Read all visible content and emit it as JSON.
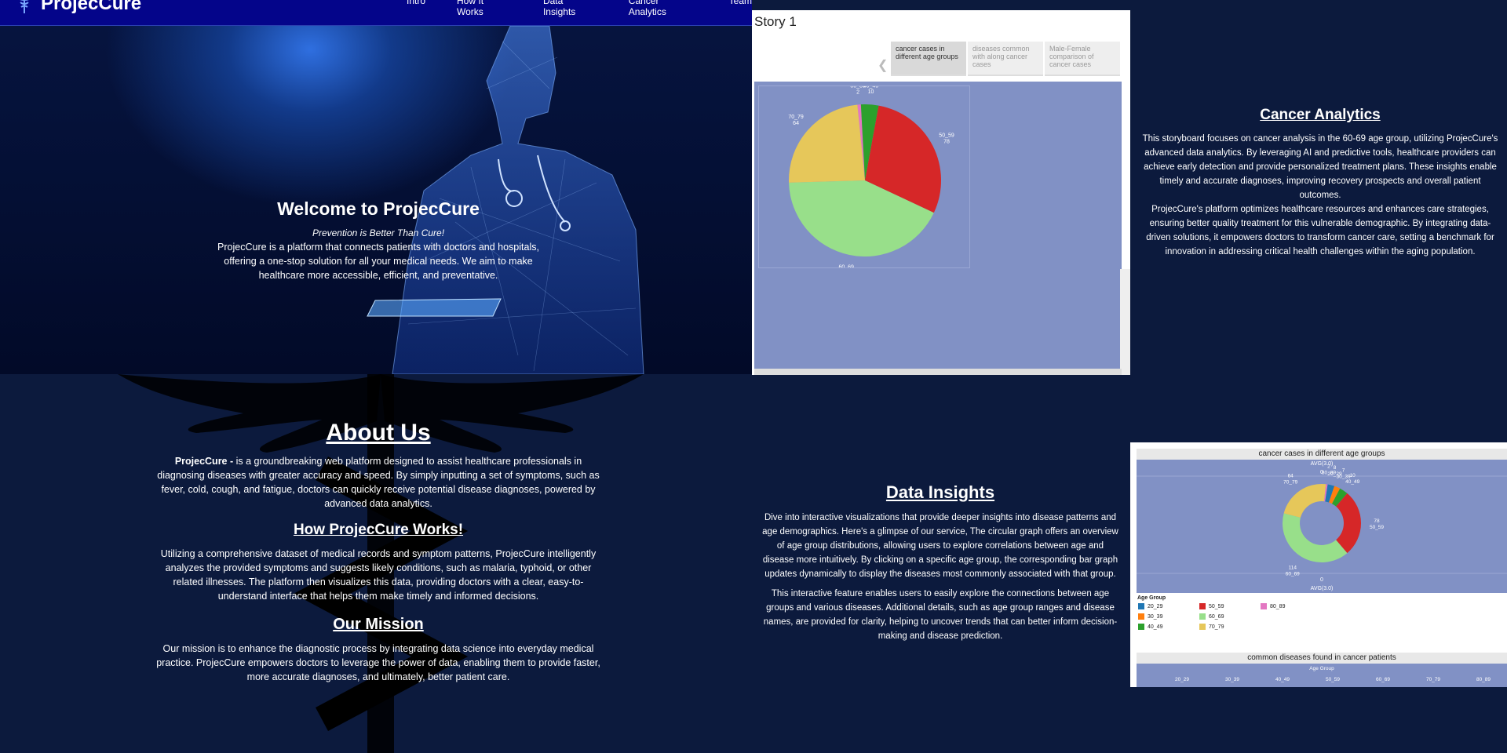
{
  "nav": {
    "brand": "ProjecCure",
    "links": [
      "Intro",
      "How It Works",
      "Data Insights",
      "Cancer Analytics",
      "Team"
    ]
  },
  "hero": {
    "title": "Welcome to ProjecCure",
    "subtitle": "Prevention is Better Than Cure!",
    "description": "ProjecCure is a platform that connects patients with doctors and hospitals, offering a one-stop solution for all your medical needs. We aim to make healthcare more accessible, efficient, and preventative."
  },
  "about": {
    "title": "About Us",
    "brand_bold": "ProjecCure -",
    "text": " is a groundbreaking web platform designed to assist healthcare professionals in diagnosing diseases with greater accuracy and speed. By simply inputting a set of symptoms, such as fever, cold, cough, and fatigue, doctors can quickly receive potential disease diagnoses, powered by advanced data analytics."
  },
  "how": {
    "title": "How ProjecCure Works!",
    "text": "Utilizing a comprehensive dataset of medical records and symptom patterns, ProjecCure intelligently analyzes the provided symptoms and suggests likely conditions, such as malaria, typhoid, or other related illnesses. The platform then visualizes this data, providing doctors with a clear, easy-to-understand interface that helps them make timely and informed decisions."
  },
  "mission": {
    "title": "Our Mission",
    "text": "Our mission is to enhance the diagnostic process by integrating data science into everyday medical practice. ProjecCure empowers doctors to leverage the power of data, enabling them to provide faster, more accurate diagnoses, and ultimately, better patient care."
  },
  "story": {
    "title": "Story 1",
    "tabs": [
      "cancer cases in different age groups",
      "diseases common with along cancer cases",
      "Male-Female comparison of cancer cases"
    ]
  },
  "cancer_analytics": {
    "title": "Cancer Analytics",
    "p1": "This storyboard focuses on cancer analysis in the 60-69 age group, utilizing ProjecCure's advanced data analytics. By leveraging AI and predictive tools, healthcare providers can achieve early detection and provide personalized treatment plans. These insights enable timely and accurate diagnoses, improving recovery prospects and overall patient outcomes.",
    "p2": "ProjecCure's platform optimizes healthcare resources and enhances care strategies, ensuring better quality treatment for this vulnerable demographic. By integrating data-driven solutions, it empowers doctors to transform cancer care, setting a benchmark for innovation in addressing critical health challenges within the aging population."
  },
  "data_insights": {
    "title": "Data Insights",
    "p1": "Dive into interactive visualizations that provide deeper insights into disease patterns and age demographics. Here's a glimpse of our service, The circular graph offers an overview of age group distributions, allowing users to explore correlations between age and disease more intuitively. By clicking on a specific age group, the corresponding bar graph updates dynamically to display the diseases most commonly associated with that group.",
    "p2": "This interactive feature enables users to easily explore the connections between age groups and various diseases. Additional details, such as age group ranges and disease names, are provided for clarity, helping to uncover trends that can better inform decision-making and disease prediction."
  },
  "dash": {
    "title1": "cancer cases in different age groups",
    "avg_label": "AVG(3.0)",
    "zero": "0",
    "legend_title": "Age Group",
    "title2": "common diseases found in cancer patients",
    "axis_title": "Age Group",
    "axis_ticks": [
      "20_29",
      "30_39",
      "40_49",
      "50_59",
      "60_69",
      "70_79",
      "80_89"
    ]
  },
  "chart_data": [
    {
      "type": "pie",
      "categories": [
        "80_89",
        "40_49",
        "50_59",
        "60_69",
        "70_79"
      ],
      "values": [
        2,
        10,
        78,
        114,
        64
      ],
      "colors": [
        "#e377c2",
        "#2ca02c",
        "#d62728",
        "#98df8a",
        "#e6c75a"
      ]
    },
    {
      "type": "pie",
      "title": "cancer cases in different age groups",
      "categories": [
        "20_29",
        "30_39",
        "40_49",
        "50_59",
        "60_69",
        "70_79",
        "80_89"
      ],
      "values": [
        8,
        7,
        10,
        78,
        114,
        64,
        2
      ],
      "colors": [
        "#1f77b4",
        "#ff7f0e",
        "#2ca02c",
        "#d62728",
        "#98df8a",
        "#e6c75a",
        "#e377c2"
      ],
      "legend_title": "Age Group"
    }
  ]
}
